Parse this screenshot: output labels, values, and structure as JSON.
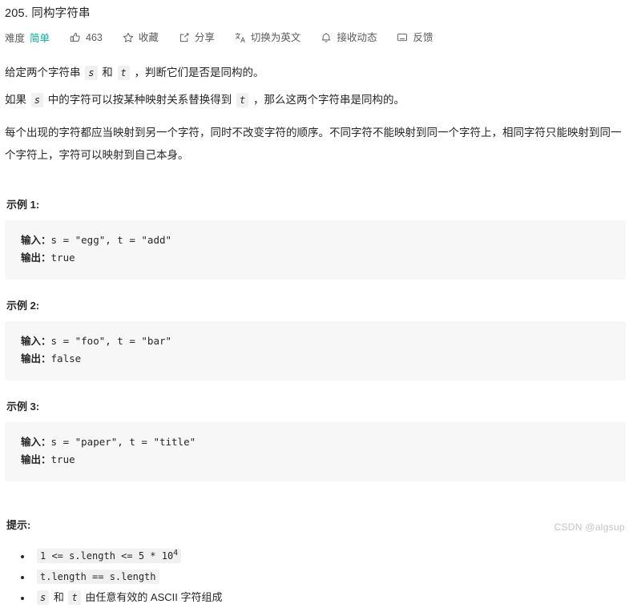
{
  "problem": {
    "title": "205. 同构字符串"
  },
  "meta": {
    "difficulty_label": "难度",
    "difficulty_value": "简单",
    "difficulty_color": "#00af9b",
    "actions": [
      {
        "icon": "thumbs-up-icon",
        "label": "463"
      },
      {
        "icon": "star-icon",
        "label": "收藏"
      },
      {
        "icon": "share-icon",
        "label": "分享"
      },
      {
        "icon": "translate-icon",
        "label": "切换为英文"
      },
      {
        "icon": "bell-icon",
        "label": "接收动态"
      },
      {
        "icon": "comment-icon",
        "label": "反馈"
      }
    ]
  },
  "description": {
    "p1": {
      "t1": "给定两个字符串 ",
      "code1": "s",
      "t2": " 和 ",
      "code2": "t",
      "t3": " ，判断它们是否是同构的。"
    },
    "p2": {
      "t1": "如果 ",
      "code1": "s",
      "t2": " 中的字符可以按某种映射关系替换得到 ",
      "code2": "t",
      "t3": " ，那么这两个字符串是同构的。"
    },
    "p3": "每个出现的字符都应当映射到另一个字符，同时不改变字符的顺序。不同字符不能映射到同一个字符上，相同字符只能映射到同一个字符上，字符可以映射到自己本身。"
  },
  "examples": [
    {
      "heading": "示例 1:",
      "input_label": "输入：",
      "input_value": "s = \"egg\", t = \"add\"",
      "output_label": "输出：",
      "output_value": "true"
    },
    {
      "heading": "示例 2:",
      "input_label": "输入：",
      "input_value": "s = \"foo\", t = \"bar\"",
      "output_label": "输出：",
      "output_value": "false"
    },
    {
      "heading": "示例 3:",
      "input_label": "输入：",
      "input_value": "s = \"paper\", t = \"title\"",
      "output_label": "输出：",
      "output_value": "true"
    }
  ],
  "hints": {
    "heading": "提示:",
    "items": [
      {
        "code_pre": "1 <= s.length <= 5 * 10",
        "sup": "4",
        "code_post": ""
      },
      {
        "code_pre": "t.length == s.length",
        "sup": "",
        "code_post": ""
      }
    ],
    "item3": {
      "code1": "s",
      "t1": " 和 ",
      "code2": "t",
      "t2": " 由任意有效的 ASCII 字符组成"
    }
  },
  "watermark": "CSDN @algsup"
}
